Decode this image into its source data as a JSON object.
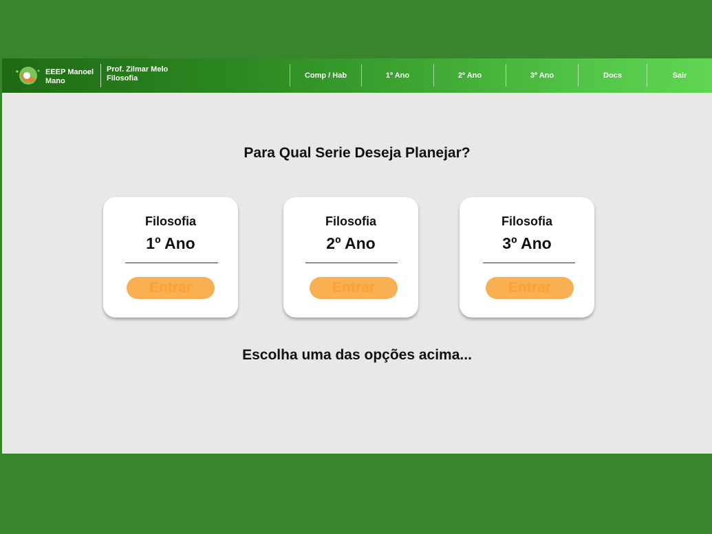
{
  "header": {
    "school_name": "EEEP Manoel Mano",
    "teacher_name": "Prof. Zilmar Melo",
    "teacher_subject": "Filosofia",
    "nav": [
      {
        "label": "Comp / Hab"
      },
      {
        "label": "1º Ano"
      },
      {
        "label": "2º Ano"
      },
      {
        "label": "3º Ano"
      },
      {
        "label": "Docs"
      },
      {
        "label": "Sair"
      }
    ]
  },
  "main": {
    "heading": "Para Qual Serie Deseja Planejar?",
    "cards": [
      {
        "subject": "Filosofia",
        "year": "1º Ano",
        "button": "Entrar"
      },
      {
        "subject": "Filosofia",
        "year": "2º Ano",
        "button": "Entrar"
      },
      {
        "subject": "Filosofia",
        "year": "3º Ano",
        "button": "Entrar"
      }
    ],
    "footer_text": "Escolha uma das opções acima..."
  },
  "colors": {
    "outer_background": "#38852e",
    "page_background": "#e9e8e6",
    "header_gradient_start": "#1f6a14",
    "header_gradient_end": "#60d654",
    "button_background": "#f9b053",
    "button_text": "#fba033"
  },
  "icons": {
    "logo": "school-logo-icon"
  }
}
